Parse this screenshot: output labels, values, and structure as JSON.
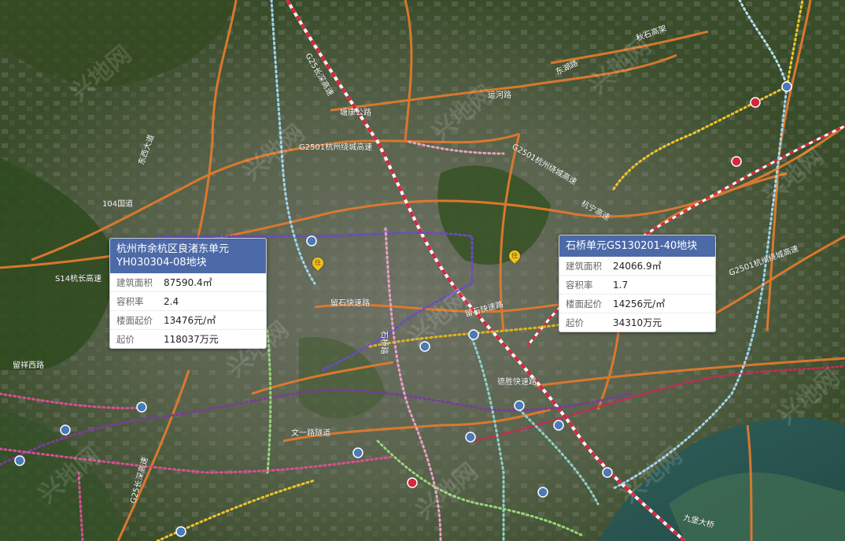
{
  "map": {
    "labels": [
      "G2501杭州绕城高速",
      "G2501杭州绕城高速",
      "G2501杭州绕城高速",
      "G25长深高速",
      "G25长深高速",
      "104国道",
      "S14杭长高速",
      "塘康公路",
      "运河路",
      "秋石高架",
      "留石快速路",
      "留石快速路",
      "文一路隧道",
      "德胜快速路",
      "留祥西路",
      "九堡大桥",
      "东西大道",
      "杭宁高速",
      "石桥路",
      "东湖路"
    ],
    "watermark": "兴地网"
  },
  "parcels": [
    {
      "title_line1": "杭州市余杭区良渚东单元",
      "title_line2": "YH030304-08地块",
      "rows": [
        {
          "label": "建筑面积",
          "value": "87590.4㎡"
        },
        {
          "label": "容积率",
          "value": "2.4"
        },
        {
          "label": "楼面起价",
          "value": "13476元/㎡"
        },
        {
          "label": "起价",
          "value": "118037万元"
        }
      ]
    },
    {
      "title_line1": "石桥单元GS130201-40地块",
      "rows": [
        {
          "label": "建筑面积",
          "value": "24066.9㎡"
        },
        {
          "label": "容积率",
          "value": "1.7"
        },
        {
          "label": "楼面起价",
          "value": "14256元/㎡"
        },
        {
          "label": "起价",
          "value": "34310万元"
        }
      ]
    }
  ],
  "pins": [
    "住",
    "住"
  ],
  "colors": {
    "popup_header": "#4d6aa8",
    "highway": "#e07a2e",
    "rail": "#d7263d",
    "metro_purple": "#6a4bc4",
    "metro_pink": "#d94f95",
    "metro_lightblue": "#9fd4ee",
    "metro_yellow": "#f0c42a",
    "metro_green": "#98d67a",
    "water": "#2c5a58"
  }
}
